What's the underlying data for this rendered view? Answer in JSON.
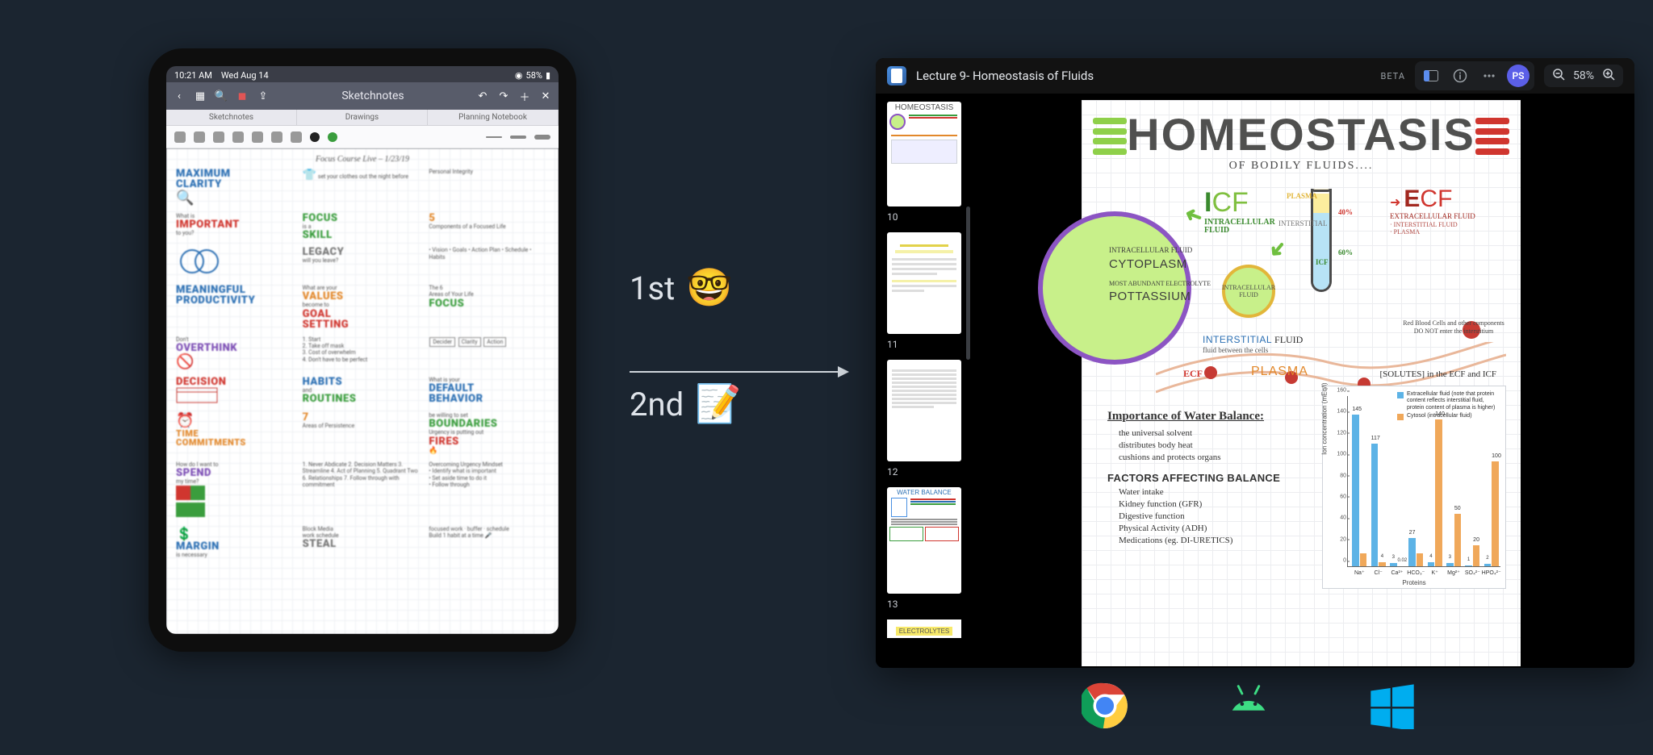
{
  "ipad": {
    "status": {
      "time": "10:21 AM",
      "date": "Wed Aug 14",
      "battery": "58%"
    },
    "toolbar": {
      "title": "Sketchnotes"
    },
    "tabs": [
      "Sketchnotes",
      "Drawings",
      "Planning Notebook"
    ],
    "note_title": "Focus Course Live – 1/23/19",
    "words": {
      "maximum": "MAXIMUM",
      "clarity": "CLARITY",
      "important": "IMPORTANT",
      "focus": "FOCUS",
      "skill": "SKILL",
      "legacy": "LEGACY",
      "values": "VALUES",
      "meaningful": "MEANINGFUL",
      "productivity": "PRODUCTIVITY",
      "goal": "GOAL",
      "setting": "SETTING",
      "decision": "DECISION",
      "habits": "HABITS",
      "routines": "ROUTINES",
      "default": "DEFAULT",
      "behavior": "BEHAVIOR",
      "boundaries": "BOUNDARIES",
      "time": "TIME",
      "commitments": "COMMITMENTS",
      "fires": "FIRES",
      "spend": "SPEND",
      "margin": "MARGIN",
      "steal": "STEAL",
      "five": "5",
      "six": "The 6",
      "seven": "7",
      "overthink": "OVERTHINK",
      "components": "Components of a Focused Life",
      "areas": "Areas of Your Life"
    }
  },
  "center": {
    "first": "1st",
    "second": "2nd",
    "emoji_nerd": "🤓",
    "emoji_memo": "📝"
  },
  "app": {
    "title": "Lecture 9- Homeostasis of Fluids",
    "beta": "BETA",
    "avatar": "PS",
    "zoom": "58%",
    "thumbs": [
      {
        "num": "10",
        "kind": "homeostasis"
      },
      {
        "num": "11",
        "kind": "text"
      },
      {
        "num": "12",
        "kind": "text"
      },
      {
        "num": "13",
        "kind": "water"
      }
    ],
    "thumb_water_title": "WATER BALANCE",
    "thumb_electrolytes": "ELECTROLYTES"
  },
  "note": {
    "title": "HOMEOSTASIS",
    "subtitle": "OF BODILY FLUIDS....",
    "icf": {
      "big_letter": "I",
      "big_rest": "CF",
      "line1": "INTRACELLULAR",
      "line2": "FLUID"
    },
    "ecf": {
      "big_letter": "E",
      "big_rest": "CF",
      "line1": "EXTRACELLULAR FLUID",
      "sub1": "· INTERSTITIAL FLUID",
      "sub2": "· PLASMA"
    },
    "cell_lines": {
      "l1": "INTRACELLULAR FLUID",
      "l1b": "CYTOPLASM",
      "l2": "MOST ABUNDANT ELECTROLYTE",
      "l2b": "POTTASSIUM"
    },
    "small_cell": "INTRACELLULAR FLUID",
    "tube": {
      "plasma": "PLASMA",
      "interstitial": "INTERSTITIAL",
      "icf": "ICF",
      "p40": "40%",
      "p60": "60%"
    },
    "interstitial_line": {
      "a": "INTERSTITIAL",
      "b": "FLUID",
      "c": "fluid between the cells"
    },
    "rbc_text": "Red Blood Cells and other components DO NOT enter the interstitium",
    "plasma_lbl": "PLASMA",
    "ecf_small": "ECF",
    "solutes": "[SOLUTES] in the ECF and ICF",
    "importance": {
      "h1": "Importance of Water Balance:",
      "items1": [
        "the universal solvent",
        "distributes body heat",
        "cushions and protects organs"
      ],
      "h2": "FACTORS AFFECTING BALANCE",
      "items2": [
        "Water intake",
        "Kidney function (GFR)",
        "Digestive function",
        "Physical Activity (ADH)",
        "Medications (eg. DI-URETICS)"
      ]
    }
  },
  "chart_data": {
    "type": "bar",
    "title": "",
    "xlabel": "Proteins",
    "ylabel": "Ion concentration (mEq/l)",
    "ylim": [
      0,
      160
    ],
    "yticks": [
      0,
      20,
      40,
      60,
      80,
      100,
      120,
      140,
      160
    ],
    "legend": [
      {
        "name": "Extracellular fluid (note that protein content reflects interstitial fluid, protein content of plasma is higher)",
        "color": "#5db3e6"
      },
      {
        "name": "Cytosol (intracellular fluid)",
        "color": "#f0a85a"
      }
    ],
    "categories": [
      "Na⁺",
      "Cl⁻",
      "Ca²⁺",
      "HCO₃⁻",
      "K⁺",
      "Mg²⁺",
      "SO₄²⁻",
      "HPO₄²⁻"
    ],
    "series": [
      {
        "name": "Extracellular",
        "color": "#5db3e6",
        "values": [
          145,
          117,
          3,
          27,
          4,
          3,
          1,
          2
        ]
      },
      {
        "name": "Cytosol",
        "color": "#f0a85a",
        "values": [
          12,
          4,
          0.02,
          12,
          140,
          50,
          20,
          100
        ]
      }
    ],
    "value_labels": {
      "show": [
        145,
        117,
        27,
        140,
        50,
        20,
        100,
        160
      ],
      "tiny": {
        "Ca²⁺_cyto": "0.02"
      }
    }
  }
}
